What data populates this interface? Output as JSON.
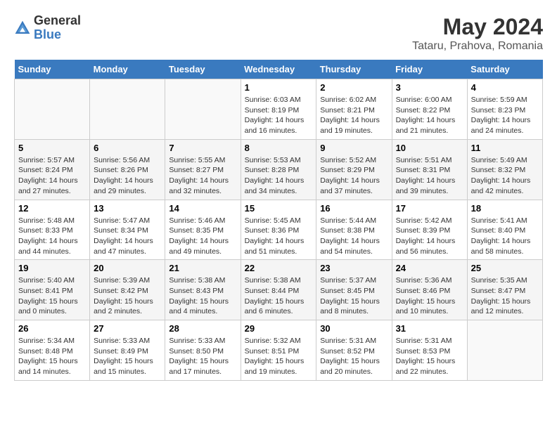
{
  "header": {
    "logo_general": "General",
    "logo_blue": "Blue",
    "month": "May 2024",
    "location": "Tataru, Prahova, Romania"
  },
  "days_of_week": [
    "Sunday",
    "Monday",
    "Tuesday",
    "Wednesday",
    "Thursday",
    "Friday",
    "Saturday"
  ],
  "weeks": [
    [
      {
        "day": "",
        "info": ""
      },
      {
        "day": "",
        "info": ""
      },
      {
        "day": "",
        "info": ""
      },
      {
        "day": "1",
        "info": "Sunrise: 6:03 AM\nSunset: 8:19 PM\nDaylight: 14 hours\nand 16 minutes."
      },
      {
        "day": "2",
        "info": "Sunrise: 6:02 AM\nSunset: 8:21 PM\nDaylight: 14 hours\nand 19 minutes."
      },
      {
        "day": "3",
        "info": "Sunrise: 6:00 AM\nSunset: 8:22 PM\nDaylight: 14 hours\nand 21 minutes."
      },
      {
        "day": "4",
        "info": "Sunrise: 5:59 AM\nSunset: 8:23 PM\nDaylight: 14 hours\nand 24 minutes."
      }
    ],
    [
      {
        "day": "5",
        "info": "Sunrise: 5:57 AM\nSunset: 8:24 PM\nDaylight: 14 hours\nand 27 minutes."
      },
      {
        "day": "6",
        "info": "Sunrise: 5:56 AM\nSunset: 8:26 PM\nDaylight: 14 hours\nand 29 minutes."
      },
      {
        "day": "7",
        "info": "Sunrise: 5:55 AM\nSunset: 8:27 PM\nDaylight: 14 hours\nand 32 minutes."
      },
      {
        "day": "8",
        "info": "Sunrise: 5:53 AM\nSunset: 8:28 PM\nDaylight: 14 hours\nand 34 minutes."
      },
      {
        "day": "9",
        "info": "Sunrise: 5:52 AM\nSunset: 8:29 PM\nDaylight: 14 hours\nand 37 minutes."
      },
      {
        "day": "10",
        "info": "Sunrise: 5:51 AM\nSunset: 8:31 PM\nDaylight: 14 hours\nand 39 minutes."
      },
      {
        "day": "11",
        "info": "Sunrise: 5:49 AM\nSunset: 8:32 PM\nDaylight: 14 hours\nand 42 minutes."
      }
    ],
    [
      {
        "day": "12",
        "info": "Sunrise: 5:48 AM\nSunset: 8:33 PM\nDaylight: 14 hours\nand 44 minutes."
      },
      {
        "day": "13",
        "info": "Sunrise: 5:47 AM\nSunset: 8:34 PM\nDaylight: 14 hours\nand 47 minutes."
      },
      {
        "day": "14",
        "info": "Sunrise: 5:46 AM\nSunset: 8:35 PM\nDaylight: 14 hours\nand 49 minutes."
      },
      {
        "day": "15",
        "info": "Sunrise: 5:45 AM\nSunset: 8:36 PM\nDaylight: 14 hours\nand 51 minutes."
      },
      {
        "day": "16",
        "info": "Sunrise: 5:44 AM\nSunset: 8:38 PM\nDaylight: 14 hours\nand 54 minutes."
      },
      {
        "day": "17",
        "info": "Sunrise: 5:42 AM\nSunset: 8:39 PM\nDaylight: 14 hours\nand 56 minutes."
      },
      {
        "day": "18",
        "info": "Sunrise: 5:41 AM\nSunset: 8:40 PM\nDaylight: 14 hours\nand 58 minutes."
      }
    ],
    [
      {
        "day": "19",
        "info": "Sunrise: 5:40 AM\nSunset: 8:41 PM\nDaylight: 15 hours\nand 0 minutes."
      },
      {
        "day": "20",
        "info": "Sunrise: 5:39 AM\nSunset: 8:42 PM\nDaylight: 15 hours\nand 2 minutes."
      },
      {
        "day": "21",
        "info": "Sunrise: 5:38 AM\nSunset: 8:43 PM\nDaylight: 15 hours\nand 4 minutes."
      },
      {
        "day": "22",
        "info": "Sunrise: 5:38 AM\nSunset: 8:44 PM\nDaylight: 15 hours\nand 6 minutes."
      },
      {
        "day": "23",
        "info": "Sunrise: 5:37 AM\nSunset: 8:45 PM\nDaylight: 15 hours\nand 8 minutes."
      },
      {
        "day": "24",
        "info": "Sunrise: 5:36 AM\nSunset: 8:46 PM\nDaylight: 15 hours\nand 10 minutes."
      },
      {
        "day": "25",
        "info": "Sunrise: 5:35 AM\nSunset: 8:47 PM\nDaylight: 15 hours\nand 12 minutes."
      }
    ],
    [
      {
        "day": "26",
        "info": "Sunrise: 5:34 AM\nSunset: 8:48 PM\nDaylight: 15 hours\nand 14 minutes."
      },
      {
        "day": "27",
        "info": "Sunrise: 5:33 AM\nSunset: 8:49 PM\nDaylight: 15 hours\nand 15 minutes."
      },
      {
        "day": "28",
        "info": "Sunrise: 5:33 AM\nSunset: 8:50 PM\nDaylight: 15 hours\nand 17 minutes."
      },
      {
        "day": "29",
        "info": "Sunrise: 5:32 AM\nSunset: 8:51 PM\nDaylight: 15 hours\nand 19 minutes."
      },
      {
        "day": "30",
        "info": "Sunrise: 5:31 AM\nSunset: 8:52 PM\nDaylight: 15 hours\nand 20 minutes."
      },
      {
        "day": "31",
        "info": "Sunrise: 5:31 AM\nSunset: 8:53 PM\nDaylight: 15 hours\nand 22 minutes."
      },
      {
        "day": "",
        "info": ""
      }
    ]
  ]
}
